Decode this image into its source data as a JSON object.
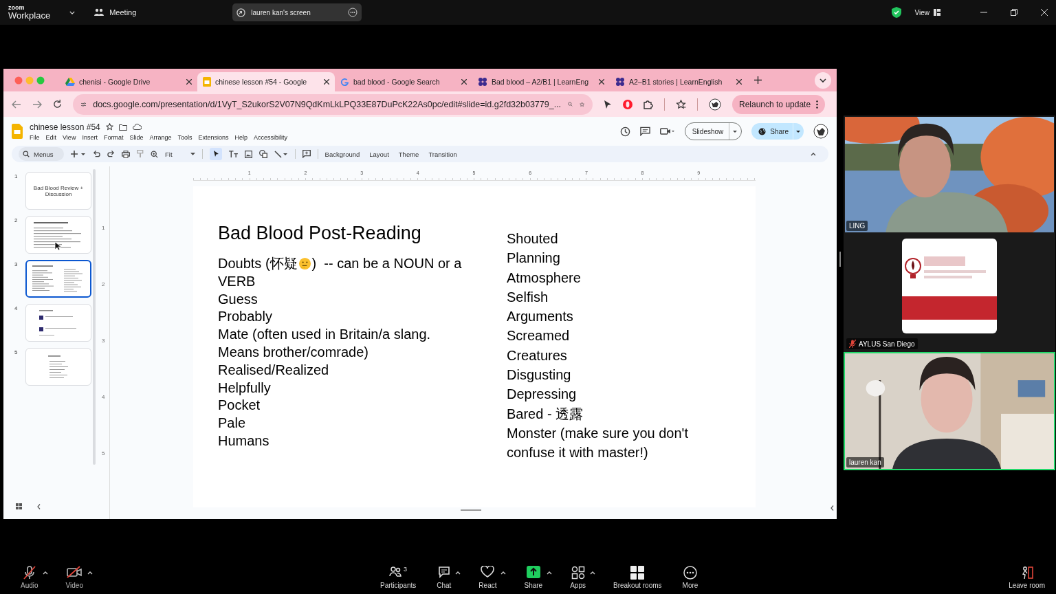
{
  "zoom_bar": {
    "brand_small": "zoom",
    "brand": "Workplace",
    "meeting": "Meeting",
    "share_pill": "lauren kan's screen",
    "view": "View"
  },
  "browser": {
    "tabs": [
      {
        "title": "chenisi - Google Drive",
        "selected": false
      },
      {
        "title": "chinese lesson #54 - Google",
        "selected": true
      },
      {
        "title": "bad blood - Google Search",
        "selected": false
      },
      {
        "title": "Bad blood – A2/B1 | LearnEng",
        "selected": false
      },
      {
        "title": "A2–B1 stories | LearnEnglish",
        "selected": false
      }
    ],
    "url": "docs.google.com/presentation/d/1VyT_S2ukorS2V07N9QdKmLkLPQ33E87DuPcK22As0pc/edit#slide=id.g2fd32b03779_...",
    "relaunch": "Relaunch to update"
  },
  "slides_app": {
    "title": "chinese lesson #54",
    "menu": [
      "File",
      "Edit",
      "View",
      "Insert",
      "Format",
      "Slide",
      "Arrange",
      "Tools",
      "Extensions",
      "Help",
      "Accessibility"
    ],
    "search": "Menus",
    "zoom": "Fit",
    "actions": [
      "Background",
      "Layout",
      "Theme",
      "Transition"
    ],
    "slideshow": "Slideshow",
    "share": "Share",
    "ruler": [
      "1",
      "2",
      "3",
      "4",
      "5",
      "6",
      "7",
      "8",
      "9"
    ],
    "vertical_ruler": [
      "1",
      "2",
      "3",
      "4",
      "5"
    ],
    "thumbnails": [
      {
        "number": "1",
        "selected": false,
        "title": "Bad Blood Review + Discussion"
      },
      {
        "number": "2",
        "selected": false
      },
      {
        "number": "3",
        "selected": true
      },
      {
        "number": "4",
        "selected": false
      },
      {
        "number": "5",
        "selected": false
      }
    ],
    "slide": {
      "title": "Bad Blood Post-Reading",
      "left": [
        {
          "kind": "emoji",
          "before": "Doubts (怀疑",
          "after": ")  -- can be a NOUN or a"
        },
        {
          "kind": "text",
          "text": "VERB"
        },
        {
          "kind": "text",
          "text": "Guess"
        },
        {
          "kind": "text",
          "text": "Probably"
        },
        {
          "kind": "text",
          "text": "Mate (often used in Britain/a slang."
        },
        {
          "kind": "text",
          "text": "Means brother/comrade)"
        },
        {
          "kind": "text",
          "text": "Realised/Realized"
        },
        {
          "kind": "text",
          "text": "Helpfully"
        },
        {
          "kind": "text",
          "text": "Pocket"
        },
        {
          "kind": "text",
          "text": "Pale"
        },
        {
          "kind": "text",
          "text": "Humans"
        }
      ],
      "right": [
        "Shouted",
        "Planning",
        "Atmosphere",
        "Selfish",
        "Arguments",
        "Screamed",
        "Creatures",
        "Disgusting",
        "Depressing",
        "Bared - 透露",
        "Monster (make sure you don't",
        "confuse it with master!)"
      ]
    }
  },
  "participants": [
    {
      "name": "LING",
      "kind": "video",
      "speaking": false,
      "muted": false
    },
    {
      "name": "AYLUS San Diego",
      "kind": "avatar",
      "speaking": false,
      "muted": true
    },
    {
      "name": "lauren kan",
      "kind": "video",
      "speaking": true,
      "muted": false
    }
  ],
  "controls": [
    {
      "label": "Audio",
      "off": true
    },
    {
      "label": "Video",
      "off": true
    },
    {
      "label": "Participants",
      "count": "3"
    },
    {
      "label": "Chat"
    },
    {
      "label": "React"
    },
    {
      "label": "Share"
    },
    {
      "label": "Apps"
    },
    {
      "label": "Breakout rooms"
    },
    {
      "label": "More"
    }
  ],
  "leave": "Leave room"
}
